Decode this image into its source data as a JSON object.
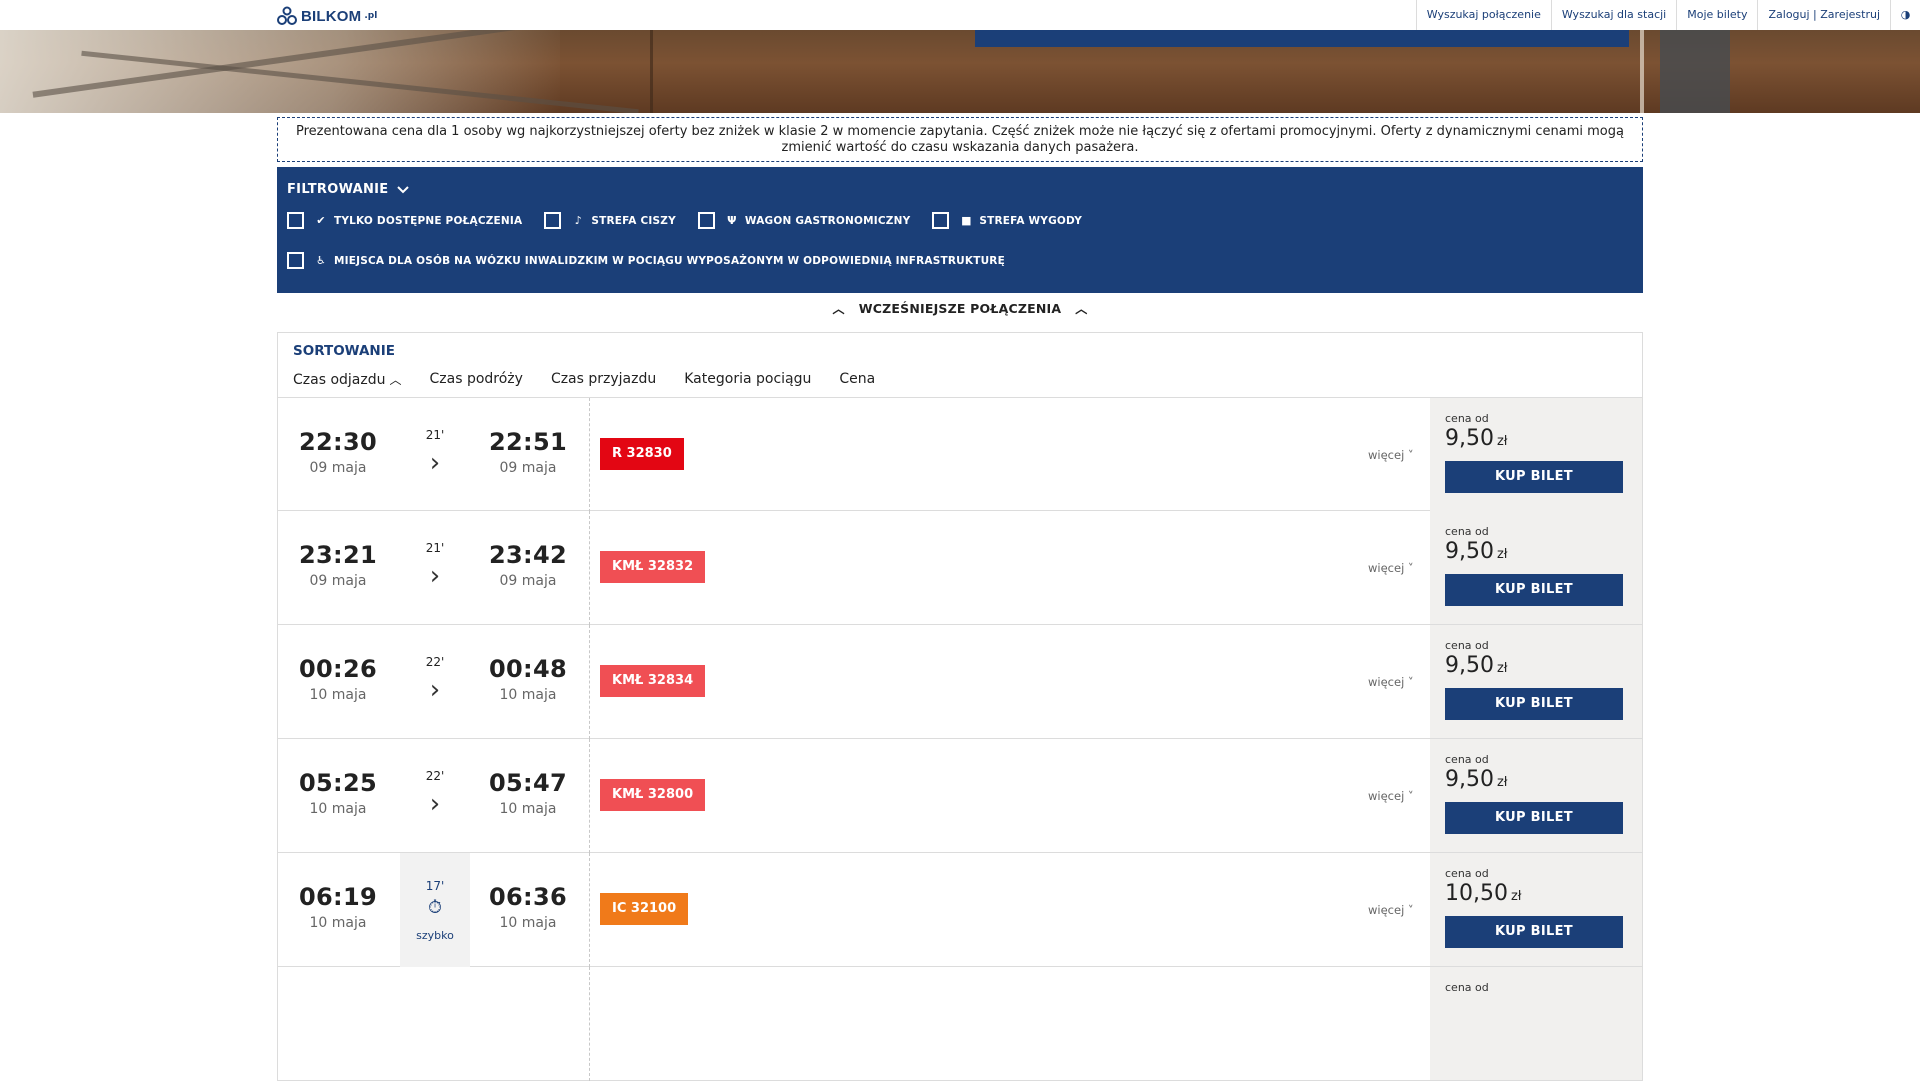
{
  "header": {
    "logo_brand": "BILKOM",
    "logo_tld": ".pl",
    "nav": {
      "search_connection": "Wyszukaj połączenie",
      "search_station": "Wyszukaj dla stacji",
      "my_tickets": "Moje bilety",
      "login_register": "Zaloguj | Zarejestruj",
      "contrast_icon": "◑"
    }
  },
  "notice": {
    "text": "Prezentowana cena dla 1 osoby wg najkorzystniejszej oferty bez zniżek w klasie 2 w momencie zapytania. Część zniżek może nie łączyć się z ofertami promocyjnymi. Oferty z dynamicznymi cenami mogą zmienić wartość do czasu wskazania danych pasażera."
  },
  "filter": {
    "title": "FILTROWANIE",
    "options": {
      "available_only": "TYLKO DOSTĘPNE POŁĄCZENIA",
      "quiet_zone": "STREFA CISZY",
      "dining_car": "WAGON GASTRONOMICZNY",
      "comfort_zone": "STREFA WYGODY",
      "wheelchair": "MIEJSCA DLA OSÓB NA WÓZKU INWALIDZKIM W POCIĄGU WYPOSAŻONYM W ODPOWIEDNIĄ INFRASTRUKTURĘ"
    }
  },
  "earlier": {
    "label": "WCZEŚNIEJSZE POŁĄCZENIA"
  },
  "sorting": {
    "title": "SORTOWANIE",
    "options": {
      "departure": "Czas odjazdu",
      "travel": "Czas podróży",
      "arrival": "Czas przyjazdu",
      "category": "Kategoria pociągu",
      "price": "Cena"
    }
  },
  "results": [
    {
      "dep_time": "22:30",
      "dep_date": "09 maja",
      "duration": "21'",
      "arr_time": "22:51",
      "arr_date": "09 maja",
      "train": "R 32830",
      "train_color": "#e30613",
      "more": "więcej ˅",
      "price_from": "cena od",
      "price": "9,50",
      "currency": "zł",
      "buy": "KUP BILET"
    },
    {
      "dep_time": "23:21",
      "dep_date": "09 maja",
      "duration": "21'",
      "arr_time": "23:42",
      "arr_date": "09 maja",
      "train": "KMŁ 32832",
      "train_color": "#f04f54",
      "more": "więcej ˅",
      "price_from": "cena od",
      "price": "9,50",
      "currency": "zł",
      "buy": "KUP BILET"
    },
    {
      "dep_time": "00:26",
      "dep_date": "10 maja",
      "duration": "22'",
      "arr_time": "00:48",
      "arr_date": "10 maja",
      "train": "KMŁ 32834",
      "train_color": "#f04f54",
      "more": "więcej ˅",
      "price_from": "cena od",
      "price": "9,50",
      "currency": "zł",
      "buy": "KUP BILET"
    },
    {
      "dep_time": "05:25",
      "dep_date": "10 maja",
      "duration": "22'",
      "arr_time": "05:47",
      "arr_date": "10 maja",
      "train": "KMŁ 32800",
      "train_color": "#f04f54",
      "more": "więcej ˅",
      "price_from": "cena od",
      "price": "9,50",
      "currency": "zł",
      "buy": "KUP BILET"
    },
    {
      "dep_time": "06:19",
      "dep_date": "10 maja",
      "duration": "17'",
      "fast_label": "szybko",
      "arr_time": "06:36",
      "arr_date": "10 maja",
      "train": "IC 32100",
      "train_color": "#f07a1a",
      "more": "więcej ˅",
      "price_from": "cena od",
      "price": "10,50",
      "currency": "zł",
      "buy": "KUP BILET"
    },
    {
      "price_from": "cena od"
    }
  ]
}
